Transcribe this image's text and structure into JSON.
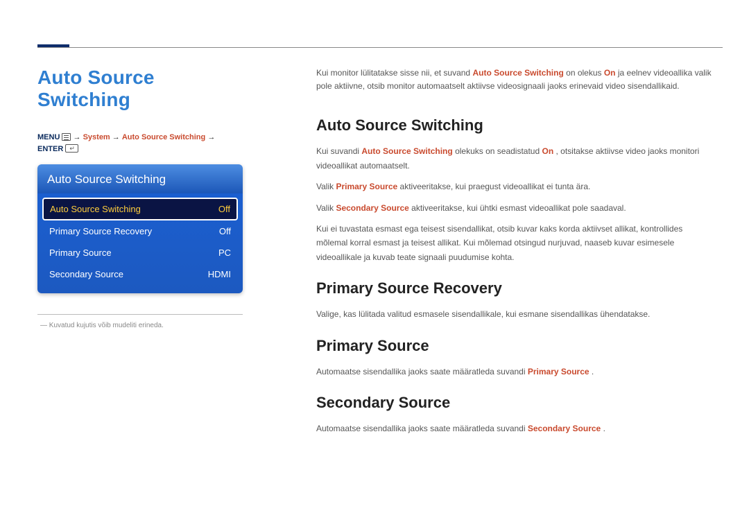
{
  "top_rule": true,
  "left": {
    "main_heading": "Auto Source Switching",
    "breadcrumb": {
      "menu": "MENU",
      "arrow1": "→",
      "system": "System",
      "arrow2": "→",
      "ass": "Auto Source Switching",
      "arrow3": "→",
      "enter": "ENTER"
    },
    "osd": {
      "title": "Auto Source Switching",
      "rows": [
        {
          "label": "Auto Source Switching",
          "value": "Off",
          "selected": true
        },
        {
          "label": "Primary Source Recovery",
          "value": "Off",
          "selected": false
        },
        {
          "label": "Primary Source",
          "value": "PC",
          "selected": false
        },
        {
          "label": "Secondary Source",
          "value": "HDMI",
          "selected": false
        }
      ]
    },
    "footnote_dash": "―",
    "footnote": "Kuvatud kujutis võib mudeliti erineda."
  },
  "right": {
    "intro_pre": "Kui monitor lülitatakse sisse nii, et suvand ",
    "intro_ass": "Auto Source Switching",
    "intro_mid": " on olekus ",
    "intro_on": "On",
    "intro_post": " ja eelnev videoallika valik pole aktiivne, otsib monitor automaatselt aktiivse videosignaali jaoks erinevaid video sisendallikaid.",
    "s1_heading": "Auto Source Switching",
    "s1_p1_pre": "Kui suvandi ",
    "s1_p1_ass": "Auto Source Switching",
    "s1_p1_mid": " olekuks on seadistatud ",
    "s1_p1_on": "On",
    "s1_p1_post": ", otsitakse aktiivse video jaoks monitori videoallikat automaatselt.",
    "s1_p2_pre": "Valik ",
    "s1_p2_ps": "Primary Source",
    "s1_p2_post": " aktiveeritakse, kui praegust videoallikat ei tunta ära.",
    "s1_p3_pre": "Valik ",
    "s1_p3_ss": "Secondary Source",
    "s1_p3_post": " aktiveeritakse, kui ühtki esmast videoallikat pole saadaval.",
    "s1_p4": "Kui ei tuvastata esmast ega teisest sisendallikat, otsib kuvar kaks korda aktiivset allikat, kontrollides mõlemal korral esmast ja teisest allikat. Kui mõlemad otsingud nurjuvad, naaseb kuvar esimesele videoallikale ja kuvab teate signaali puudumise kohta.",
    "s2_heading": "Primary Source Recovery",
    "s2_p1": "Valige, kas lülitada valitud esmasele sisendallikale, kui esmane sisendallikas ühendatakse.",
    "s3_heading": "Primary Source",
    "s3_p1_pre": "Automaatse sisendallika jaoks saate määratleda suvandi ",
    "s3_p1_ps": "Primary Source",
    "s3_p1_post": ".",
    "s4_heading": "Secondary Source",
    "s4_p1_pre": "Automaatse sisendallika jaoks saate määratleda suvandi ",
    "s4_p1_ss": "Secondary Source",
    "s4_p1_post": "."
  }
}
